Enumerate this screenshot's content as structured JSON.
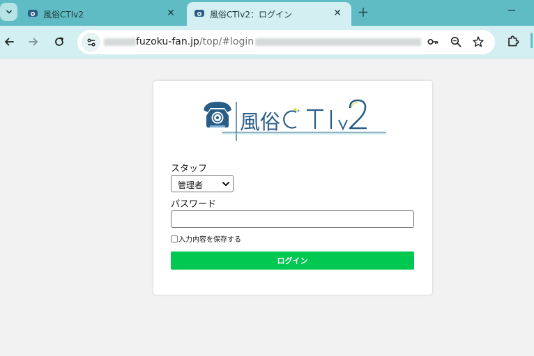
{
  "browser": {
    "tabs": [
      {
        "title": "風俗CTIv2",
        "active": false
      },
      {
        "title": "風俗CTIv2：ログイン",
        "active": true
      }
    ],
    "new_tab_glyph": "+",
    "close_glyph": "✕",
    "address": {
      "host": "fuzoku-fan.jp",
      "path": "/top/#login"
    },
    "icons": [
      "tab-search-icon",
      "favicon-phone-icon",
      "close-icon",
      "new-tab-icon",
      "minimize-icon",
      "back-icon",
      "forward-icon",
      "reload-icon",
      "site-info-icon",
      "password-key-icon",
      "zoom-icon",
      "bookmark-star-icon",
      "extensions-icon"
    ]
  },
  "login": {
    "logo_text": "風俗CTIv2",
    "staff_label": "スタッフ",
    "staff_selected": "管理者",
    "password_label": "パスワード",
    "password_value": "",
    "remember_label": "入力内容を保存する",
    "remember_checked": false,
    "submit_label": "ログイン"
  },
  "colors": {
    "tabstrip": "#5fbcc4",
    "toolbar": "#d3eff1",
    "page_bg": "#f2f2f2",
    "login_button": "#00c851",
    "logo_blue": "#2a5d86"
  }
}
